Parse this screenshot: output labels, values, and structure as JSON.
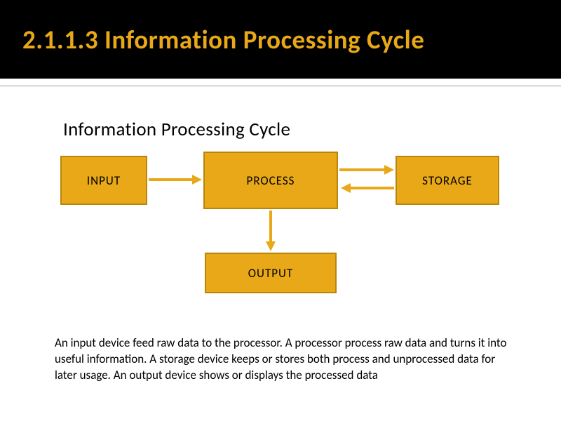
{
  "header": {
    "title": "2.1.1.3 Information Processing Cycle"
  },
  "subtitle": "Information Processing Cycle",
  "diagram": {
    "nodes": {
      "input": "INPUT",
      "process": "PROCESS",
      "storage": "STORAGE",
      "output": "OUTPUT"
    },
    "edges": [
      {
        "from": "input",
        "to": "process",
        "dir": "right"
      },
      {
        "from": "process",
        "to": "storage",
        "dir": "right"
      },
      {
        "from": "storage",
        "to": "process",
        "dir": "left"
      },
      {
        "from": "process",
        "to": "output",
        "dir": "down"
      }
    ],
    "box_color": "#e8a817",
    "border_color": "#b8860b"
  },
  "description": "An input device feed raw data to the processor. A processor process raw data and turns it into useful information. A storage device keeps or stores both process and unprocessed data for later usage. An output device shows or displays the processed data"
}
